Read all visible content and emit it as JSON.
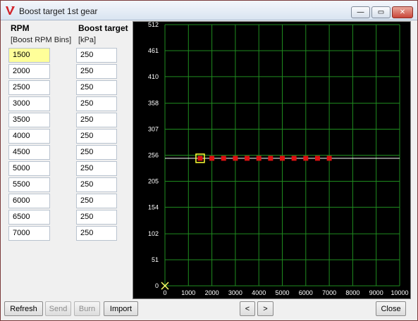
{
  "window": {
    "title": "Boost target 1st gear",
    "buttons": {
      "minimize": "—",
      "maximize": "▭",
      "close": "✕"
    }
  },
  "table": {
    "col1_header": "RPM",
    "col1_sub": "[Boost RPM Bins]",
    "col2_header": "Boost target",
    "col2_sub": "[kPa]",
    "rpm_values": [
      "1500",
      "2000",
      "2500",
      "3000",
      "3500",
      "4000",
      "4500",
      "5000",
      "5500",
      "6000",
      "6500",
      "7000"
    ],
    "boost_values": [
      "250",
      "250",
      "250",
      "250",
      "250",
      "250",
      "250",
      "250",
      "250",
      "250",
      "250",
      "250"
    ]
  },
  "chart_data": {
    "type": "scatter",
    "title": "",
    "xlabel": "",
    "ylabel": "",
    "xlim": [
      0,
      10000
    ],
    "ylim": [
      0,
      512
    ],
    "x_ticks": [
      "0",
      "1000",
      "2000",
      "3000",
      "4000",
      "5000",
      "6000",
      "7000",
      "8000",
      "9000",
      "10000"
    ],
    "y_ticks": [
      "0",
      "51",
      "102",
      "154",
      "205",
      "256",
      "307",
      "358",
      "410",
      "461",
      "512"
    ],
    "grid": true,
    "x": [
      1500,
      2000,
      2500,
      3000,
      3500,
      4000,
      4500,
      5000,
      5500,
      6000,
      6500,
      7000
    ],
    "y": [
      250,
      250,
      250,
      250,
      250,
      250,
      250,
      250,
      250,
      250,
      250,
      250
    ],
    "selected_index": 0,
    "crosshair_y": 250,
    "cursor_marker": {
      "x": 0,
      "y": 0
    },
    "colors": {
      "background": "#000000",
      "grid": "#1f8c1f",
      "points": "#dd1111",
      "selected_border": "#ffff33",
      "crosshair": "#ffffff",
      "labels": "#ffffff",
      "cursor": "#ffff66"
    }
  },
  "footer": {
    "refresh": "Refresh",
    "send": "Send",
    "burn": "Burn",
    "import": "Import",
    "prev": "<",
    "next": ">",
    "close": "Close"
  }
}
